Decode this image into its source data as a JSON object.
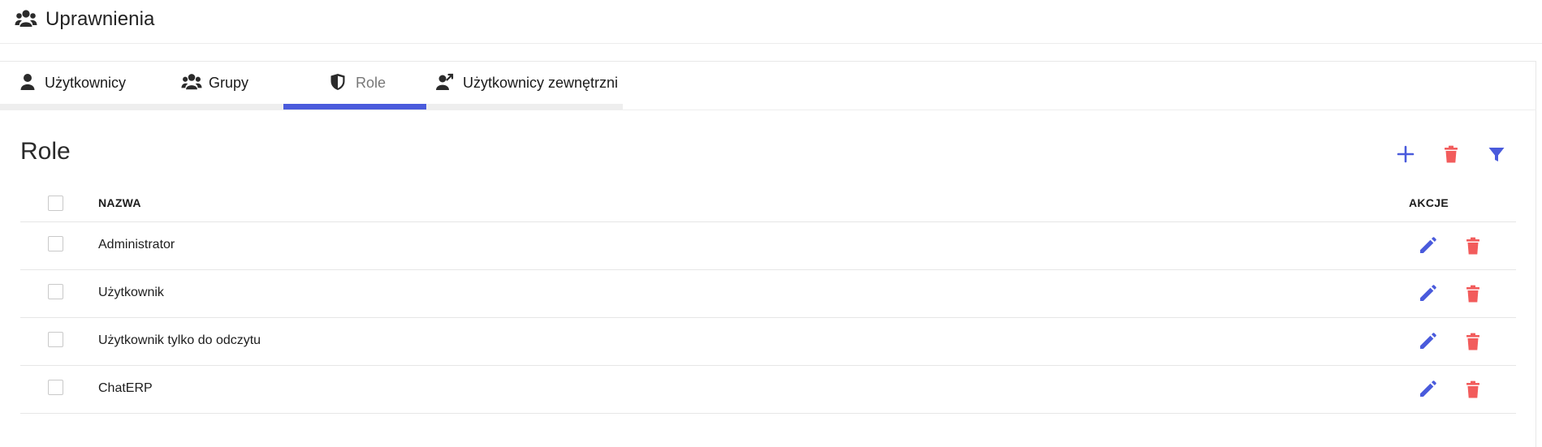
{
  "header": {
    "title": "Uprawnienia",
    "icon": "users-group-icon"
  },
  "tabs": [
    {
      "label": "Użytkownicy",
      "icon": "user-icon",
      "active": false
    },
    {
      "label": "Grupy",
      "icon": "users-group-icon",
      "active": false
    },
    {
      "label": "Role",
      "icon": "shield-icon",
      "active": true
    },
    {
      "label": "Użytkownicy zewnętrzni",
      "icon": "external-user-icon",
      "active": false
    }
  ],
  "section": {
    "title": "Role"
  },
  "toolbar": {
    "add_icon": "plus-icon",
    "delete_icon": "trash-icon",
    "filter_icon": "filter-icon"
  },
  "table": {
    "columns": {
      "name": "NAZWA",
      "actions": "AKCJE"
    },
    "rows": [
      {
        "name": "Administrator"
      },
      {
        "name": "Użytkownik"
      },
      {
        "name": "Użytkownik tylko do odczytu"
      },
      {
        "name": "ChatERP"
      }
    ]
  },
  "colors": {
    "accent": "#4a5bdc",
    "danger": "#f25c5c",
    "tab_inactive": "#eeeeee"
  }
}
